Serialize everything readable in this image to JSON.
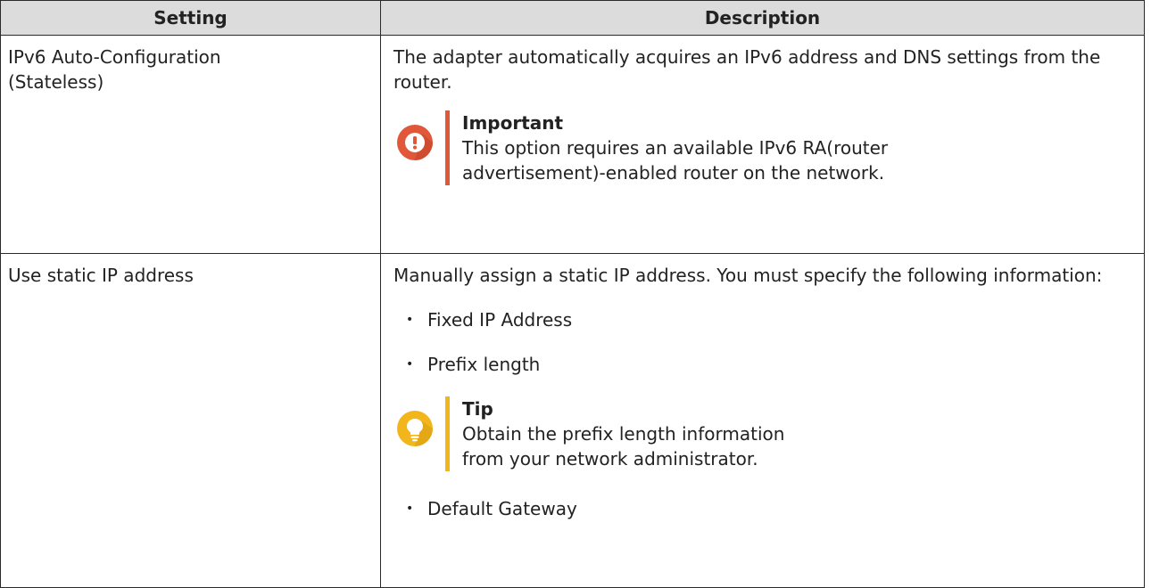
{
  "table": {
    "headers": {
      "setting": "Setting",
      "description": "Description"
    },
    "rows": [
      {
        "setting": "IPv6 Auto-Configuration (Stateless)",
        "description": "The adapter automatically acquires an IPv6 address and DNS settings from the router.",
        "callout": {
          "type": "important",
          "icon": "exclamation-icon",
          "color": "#e0573a",
          "title": "Important",
          "text": "This option requires an available IPv6 RA(router advertisement)-enabled router on the network."
        }
      },
      {
        "setting": "Use static IP address",
        "description": "Manually assign a static IP address. You must specify the following information:",
        "bullets": [
          "Fixed IP Address",
          "Prefix length"
        ],
        "callout": {
          "type": "tip",
          "icon": "lightbulb-icon",
          "color": "#f2b51c",
          "title": "Tip",
          "text": "Obtain the prefix length information from your network administrator."
        },
        "bullets_after": [
          "Default Gateway"
        ]
      }
    ]
  }
}
